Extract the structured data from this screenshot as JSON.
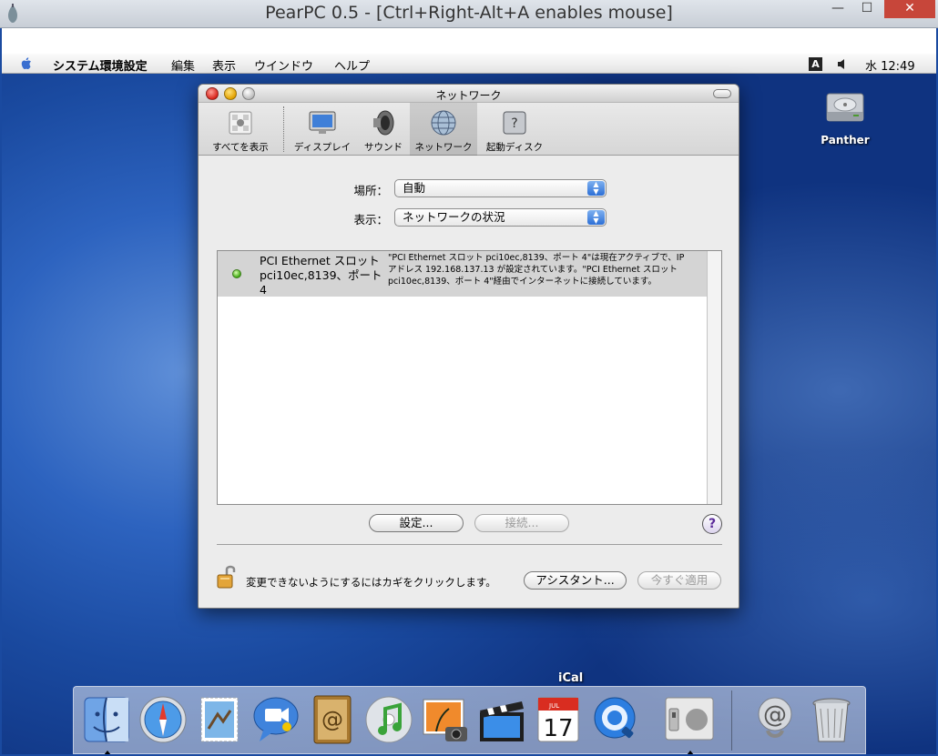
{
  "host": {
    "title": "PearPC 0.5 - [Ctrl+Right-Alt+A enables mouse]",
    "minimize": "—",
    "maximize": "☐",
    "close": "✕"
  },
  "menubar": {
    "app": "システム環境設定",
    "items": [
      "編集",
      "表示",
      "ウインドウ",
      "ヘルプ"
    ],
    "ime": "A",
    "clock": "水 12:49"
  },
  "desktop": {
    "drive_label": "Panther"
  },
  "window": {
    "title": "ネットワーク",
    "toolbar": [
      "すべてを表示",
      "ディスプレイ",
      "サウンド",
      "ネットワーク",
      "起動ディスク"
    ],
    "location_label": "場所：",
    "location_value": "自動",
    "show_label": "表示：",
    "show_value": "ネットワークの状況",
    "port_name": "PCI Ethernet スロット pci10ec,8139、ポート 4",
    "port_desc": "\"PCI Ethernet スロット pci10ec,8139、ポート 4\"は現在アクティブで、IP アドレス 192.168.137.13 が設定されています。\"PCI Ethernet スロット pci10ec,8139、ポート 4\"経由でインターネットに接続しています。",
    "configure_button": "設定...",
    "connect_button": "接続...",
    "help_button": "?",
    "lock_text": "変更できないようにするにはカギをクリックします。",
    "assistant_button": "アシスタント...",
    "apply_button": "今すぐ適用"
  },
  "dock": {
    "hover_label": "iCal",
    "ical_month": "JUL",
    "ical_day": "17"
  },
  "colors": {
    "accent": "#2c6fd6",
    "status_active": "#3fa912",
    "host_close": "#c7463a"
  }
}
